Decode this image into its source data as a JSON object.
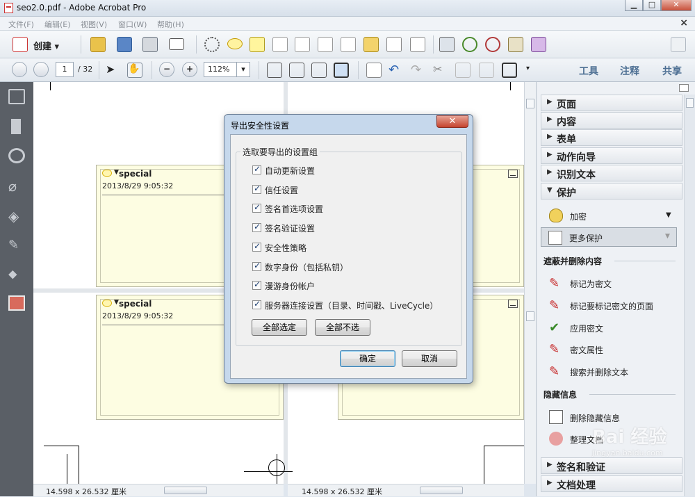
{
  "window": {
    "title": "seo2.0.pdf - Adobe Acrobat Pro",
    "min_label": "▁",
    "max_label": "□",
    "close_label": "✕"
  },
  "menubar": {
    "items": [
      "文件(F)",
      "编辑(E)",
      "视图(V)",
      "窗口(W)",
      "帮助(H)"
    ],
    "close_label": "×"
  },
  "toolbar": {
    "create_label": "创建 ▾"
  },
  "nav": {
    "page_current": "1",
    "page_total": "/ 32",
    "zoom": "112%"
  },
  "right_links": {
    "tools": "工具",
    "comment": "注释",
    "share": "共享"
  },
  "document": {
    "notes": [
      {
        "author": "special",
        "date": "2013/8/29 9:05:32"
      },
      {
        "author": "special",
        "date": "2013/8/29 9:05:32"
      }
    ],
    "page_size": "14.598 x 26.532 厘米"
  },
  "dialog": {
    "title": "导出安全性设置",
    "close_label": "✕",
    "group_label": "选取要导出的设置组",
    "options": [
      {
        "label": "自动更新设置",
        "checked": true
      },
      {
        "label": "信任设置",
        "checked": true
      },
      {
        "label": "签名首选项设置",
        "checked": true
      },
      {
        "label": "签名验证设置",
        "checked": true
      },
      {
        "label": "安全性策略",
        "checked": true
      },
      {
        "label": "数字身份（包括私钥）",
        "checked": true
      },
      {
        "label": "漫游身份帐户",
        "checked": true
      },
      {
        "label": "服务器连接设置（目录、时间戳、LiveCycle）",
        "checked": true
      }
    ],
    "select_all": "全部选定",
    "select_none": "全部不选",
    "ok": "确定",
    "cancel": "取消"
  },
  "right_panel": {
    "sections": [
      {
        "label": "页面"
      },
      {
        "label": "内容"
      },
      {
        "label": "表单"
      },
      {
        "label": "动作向导"
      },
      {
        "label": "识别文本"
      },
      {
        "label": "保护"
      }
    ],
    "protect_items": {
      "encrypt": "加密",
      "more_protect": "更多保护"
    },
    "redact_group": "遮蔽并删除内容",
    "redact_items": [
      "标记为密文",
      "标记要标记密文的页面",
      "应用密文",
      "密文属性",
      "搜索并删除文本"
    ],
    "hidden_group": "隐藏信息",
    "hidden_items": [
      "删除隐藏信息",
      "整理文档"
    ],
    "bottom_sections": [
      {
        "label": "签名和验证"
      },
      {
        "label": "文档处理"
      }
    ]
  },
  "watermark": {
    "text": "Bai 经验",
    "url": "jingyan.baidu.com"
  },
  "colors": {
    "accent": "#4d6f93",
    "dialog_frame": "#c6d8ec",
    "note_bg": "#fdfde2",
    "left_nav": "#5a5f66"
  }
}
